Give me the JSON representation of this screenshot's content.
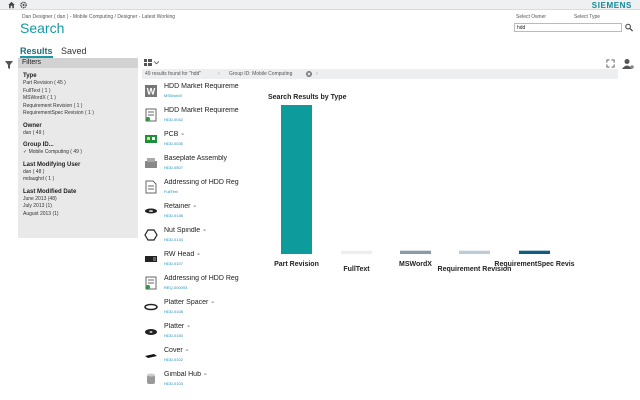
{
  "header": {
    "brand": "SIEMENS",
    "breadcrumb": "Dan Designer ( dan ) - Mobile Computing / Designer - Latest Working",
    "title": "Search",
    "select_owner_label": "Select Owner",
    "select_type_label": "Select Type",
    "search_value": "hdd"
  },
  "tabs": [
    {
      "label": "Results",
      "active": true
    },
    {
      "label": "Saved",
      "active": false
    }
  ],
  "filters": {
    "title": "Filters",
    "groups": [
      {
        "title": "Type",
        "items": [
          "Part Revision ( 45 )",
          "FullText ( 1 )",
          "MSWordX ( 1 )",
          "Requirement Revision ( 1 )",
          "RequirementSpec Revision ( 1 )"
        ]
      },
      {
        "title": "Owner",
        "items": [
          "dan ( 49 )"
        ]
      },
      {
        "title": "Group ID...",
        "items": [
          "✓ Mobile Computing ( 49 )"
        ]
      },
      {
        "title": "Last Modifying User",
        "items": [
          "dan ( 48 )",
          "mdaughd ( 1 )"
        ]
      },
      {
        "title": "Last Modified Date",
        "items": [
          "June 2013 (48)",
          "July 2013 (1)",
          "August 2013 (1)"
        ]
      }
    ]
  },
  "results_bar": {
    "count_text": "49 results found for \"hdd\"",
    "chip_text": "Group ID: Mobile Computing"
  },
  "results": [
    {
      "name": "HDD Market Requireme",
      "id": "MSWordX",
      "icon": "word-doc-icon",
      "linked": false
    },
    {
      "name": "HDD Market Requireme",
      "id": "HDD-0042",
      "icon": "requirement-icon",
      "linked": false
    },
    {
      "name": "PCB",
      "id": "HDD-0035",
      "icon": "pcb-icon",
      "linked": true
    },
    {
      "name": "Baseplate Assembly",
      "id": "HDD-0507",
      "icon": "assembly-icon",
      "linked": false
    },
    {
      "name": "Addressing of HDD Reg",
      "id": "FullText",
      "icon": "document-icon",
      "linked": false
    },
    {
      "name": "Retainer",
      "id": "HDD-0136",
      "icon": "retainer-icon",
      "linked": true
    },
    {
      "name": "Nut Spindle",
      "id": "HDD-0134",
      "icon": "nut-icon",
      "linked": true
    },
    {
      "name": "RW Head",
      "id": "HDD-0107",
      "icon": "rw-head-icon",
      "linked": true
    },
    {
      "name": "Addressing of HDD Reg",
      "id": "REQ-000093",
      "icon": "requirement-icon",
      "linked": false
    },
    {
      "name": "Platter Spacer",
      "id": "HDD-0108",
      "icon": "spacer-icon",
      "linked": true
    },
    {
      "name": "Platter",
      "id": "HDD-0150",
      "icon": "platter-icon",
      "linked": true
    },
    {
      "name": "Cover",
      "id": "HDD-0102",
      "icon": "cover-icon",
      "linked": true
    },
    {
      "name": "Gimbal Hub",
      "id": "HDD-0103",
      "icon": "hub-icon",
      "linked": true
    }
  ],
  "chart_data": {
    "type": "bar",
    "title": "Search Results by Type",
    "categories": [
      "Part Revision",
      "FullText",
      "MSWordX",
      "Requirement Revision",
      "RequirementSpec Revis"
    ],
    "values": [
      45,
      1,
      1,
      1,
      1
    ],
    "colors": [
      "#0e9b9b",
      "#eeeeee",
      "#8c9aa7",
      "#bccbd6",
      "#0f5d80"
    ],
    "xlabel": "",
    "ylabel": "",
    "grid": false
  }
}
